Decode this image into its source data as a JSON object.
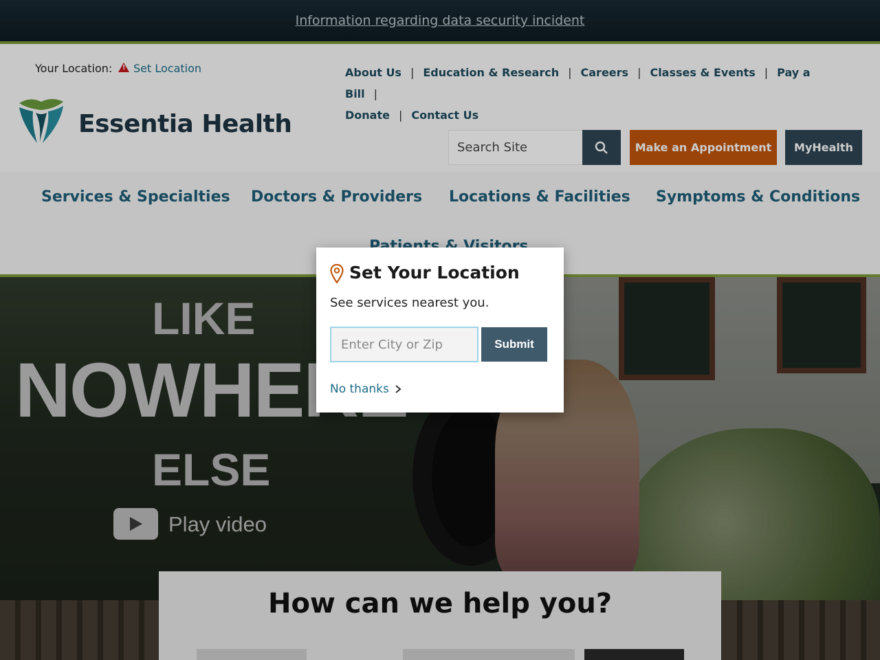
{
  "alert": {
    "link_text": "Information regarding data security incident"
  },
  "header": {
    "location_label": "Your Location:",
    "set_location": "Set Location",
    "brand": "Essentia Health",
    "util_nav": [
      "About Us",
      "Education & Research",
      "Careers",
      "Classes & Events",
      "Pay a Bill",
      "Donate",
      "Contact Us"
    ],
    "search_placeholder": "Search Site",
    "appointment_button": "Make an Appointment",
    "myhealth_button": "MyHealth"
  },
  "main_nav": [
    "Services & Specialties",
    "Doctors & Providers",
    "Locations & Facilities",
    "Symptoms & Conditions",
    "Patients & Visitors"
  ],
  "hero": {
    "line1": "LIKE",
    "line2": "NOWHERE",
    "line3": "ELSE",
    "play_label": "Play video"
  },
  "help": {
    "title": "How can we help you?"
  },
  "modal": {
    "title": "Set Your Location",
    "subtitle": "See services nearest you.",
    "input_placeholder": "Enter City or Zip",
    "submit_label": "Submit",
    "no_thanks": "No thanks"
  },
  "colors": {
    "accent_green": "#7d9a3a",
    "nav_blue": "#1f5e78",
    "appointment_orange": "#c2560c",
    "dark_slate": "#2e4554"
  }
}
